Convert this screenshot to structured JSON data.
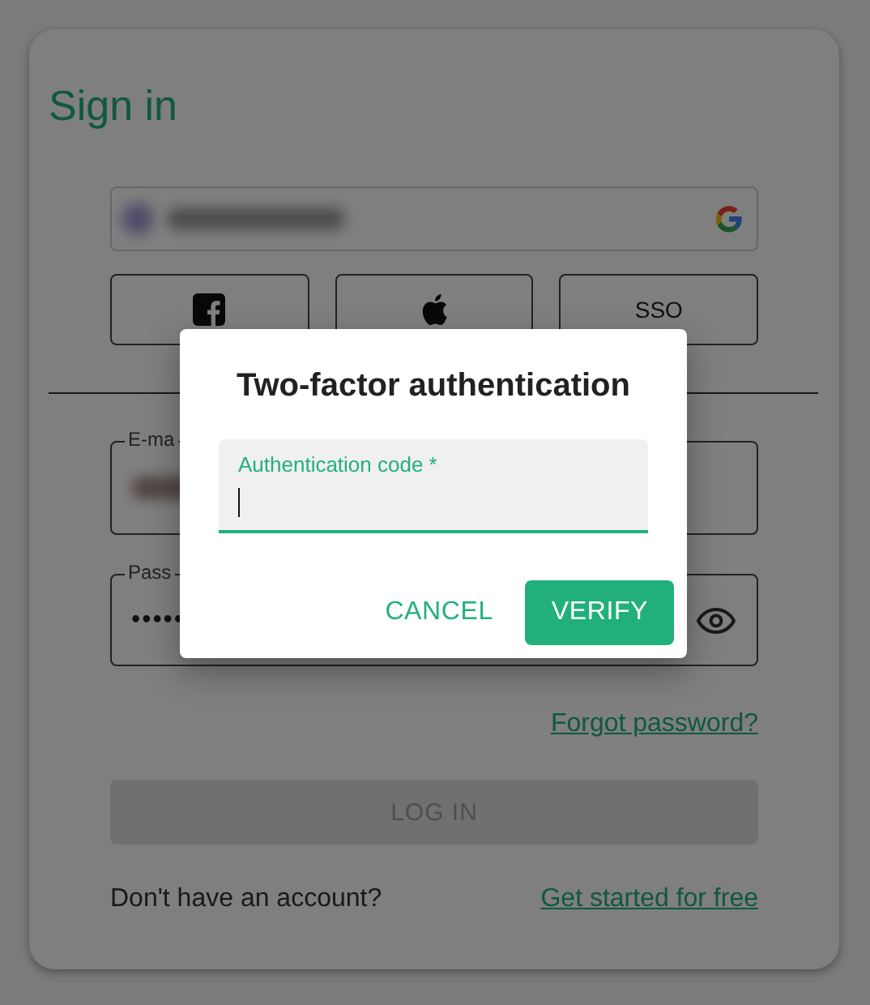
{
  "sign_in": {
    "title": "Sign in",
    "social_buttons": [
      {
        "kind": "facebook"
      },
      {
        "kind": "apple"
      },
      {
        "kind": "text",
        "label": "SSO"
      }
    ],
    "email": {
      "label": "E-ma"
    },
    "password": {
      "label": "Pass",
      "value": "•••••"
    },
    "forgot_link": "Forgot password?",
    "login_button": {
      "label": "LOG IN",
      "disabled": true
    },
    "signup_prompt": "Don't have an account?",
    "signup_link": "Get started for free"
  },
  "dialog": {
    "title": "Two-factor authentication",
    "field": {
      "label": "Authentication code *",
      "focused": true
    },
    "buttons": [
      {
        "label": "CANCEL",
        "kind": "text"
      },
      {
        "label": "VERIFY",
        "kind": "contained"
      }
    ]
  }
}
